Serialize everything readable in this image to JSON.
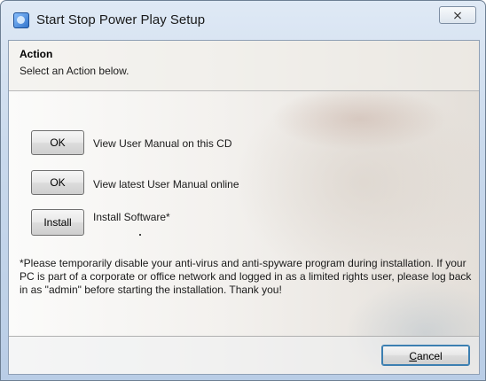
{
  "window": {
    "title": "Start Stop Power Play Setup",
    "close_glyph": "⨯"
  },
  "header": {
    "title": "Action",
    "subtitle": "Select an Action below."
  },
  "actions": [
    {
      "button": "OK",
      "label": "View User Manual on this CD"
    },
    {
      "button": "OK",
      "label": "View latest User Manual online"
    },
    {
      "button": "Install",
      "label": "Install Software*"
    }
  ],
  "notice": "*Please temporarily disable your anti-virus and anti-spyware program during installation. If your PC is part of a corporate or office network and logged in as a limited rights user, please log back in as \"admin\" before starting the installation. Thank you!",
  "footer": {
    "cancel_mnemonic": "C",
    "cancel_rest": "ancel"
  }
}
